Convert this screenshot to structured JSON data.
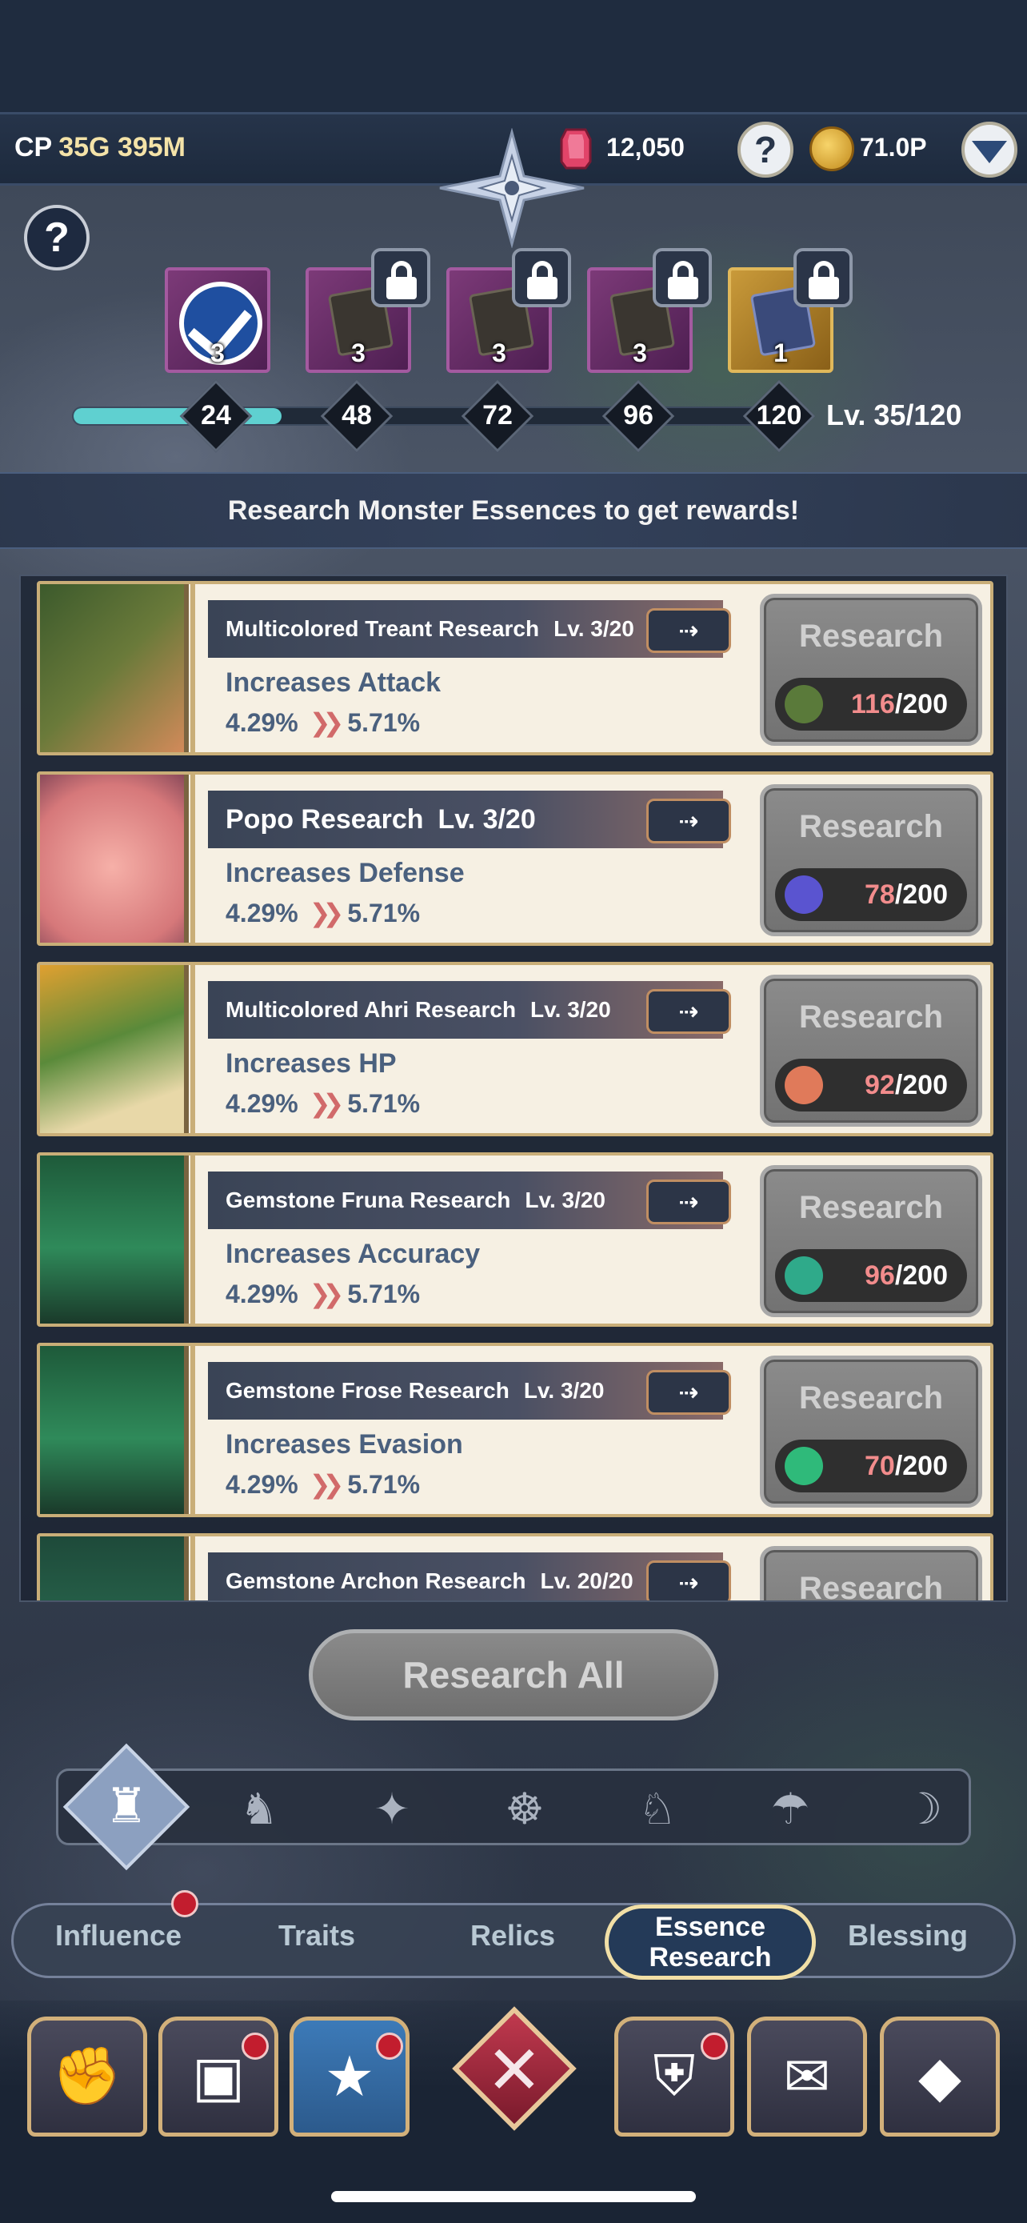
{
  "header": {
    "cp_label": "CP",
    "cp_value": "35G 395M",
    "gems": "12,050",
    "help_label": "?",
    "coins": "71.0P"
  },
  "rewards": {
    "help_label": "?",
    "items": [
      {
        "count": "3",
        "state": "claimed"
      },
      {
        "count": "3",
        "state": "locked"
      },
      {
        "count": "3",
        "state": "locked"
      },
      {
        "count": "3",
        "state": "locked"
      },
      {
        "count": "1",
        "state": "locked"
      }
    ],
    "milestones": [
      "24",
      "48",
      "72",
      "96",
      "120"
    ],
    "progress_fraction": 0.29,
    "level_text": "Lv. 35/120"
  },
  "banner": "Research Monster Essences to get rewards!",
  "research_list": [
    {
      "name": "Multicolored Treant Research",
      "level": "Lv. 3/20",
      "stat": "Increases Attack",
      "from": "4.29%",
      "to": "5.71%",
      "button": "Research",
      "have": "116",
      "need": "/200",
      "icon": "branch-icon"
    },
    {
      "name": "Popo Research",
      "level": "Lv. 3/20",
      "stat": "Increases Defense",
      "from": "4.29%",
      "to": "5.71%",
      "button": "Research",
      "have": "78",
      "need": "/200",
      "icon": "slime-icon"
    },
    {
      "name": "Multicolored Ahri Research",
      "level": "Lv. 3/20",
      "stat": "Increases HP",
      "from": "4.29%",
      "to": "5.71%",
      "button": "Research",
      "have": "92",
      "need": "/200",
      "icon": "flower-icon"
    },
    {
      "name": "Gemstone Fruna Research",
      "level": "Lv. 3/20",
      "stat": "Increases Accuracy",
      "from": "4.29%",
      "to": "5.71%",
      "button": "Research",
      "have": "96",
      "need": "/200",
      "icon": "crystal-icon"
    },
    {
      "name": "Gemstone Frose Research",
      "level": "Lv. 3/20",
      "stat": "Increases Evasion",
      "from": "4.29%",
      "to": "5.71%",
      "button": "Research",
      "have": "70",
      "need": "/200",
      "icon": "crystal-icon"
    },
    {
      "name": "Gemstone Archon Research",
      "level": "Lv. 20/20",
      "button": "Research"
    }
  ],
  "research_all": "Research All",
  "tabs": {
    "influence": "Influence",
    "traits": "Traits",
    "relics": "Relics",
    "essence_line1": "Essence",
    "essence_line2": "Research",
    "blessing": "Blessing"
  },
  "close_label": "✕",
  "colors": {
    "accent": "#5fd0d0",
    "gold_border": "#c9ae78",
    "notification": "#c21d2e",
    "cost_have": "#f28c8c"
  }
}
